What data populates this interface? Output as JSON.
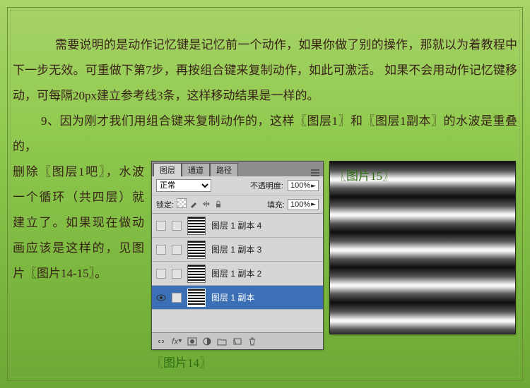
{
  "paragraphs": {
    "p1": "需要说明的是动作记忆键是记忆前一个动作，如果你做了别的操作，那就以为着教程中下一步无效。可重做下第7步，再按组合键来复制动作，如此可激活。 如果不会用动作记忆键移动，可每隔20px建立参考线3条，这样移动结果是一样的。",
    "p2": "9、因为刚才我们用组合键来复制动作的，这样〖图层1〗和〖图层1副本〗的水波是重叠的，",
    "p2b": "删除〖图层1吧〗，水波一个循环（共四层）就建立了。如果现在做动画应该是这样的，见图片〖图片14-15〗。",
    "caption14": "〖图片14〗",
    "caption15": "〖图片15〗"
  },
  "panel": {
    "tabs": {
      "layers": "图层",
      "channels": "通道",
      "paths": "路径"
    },
    "blend_mode": "正常",
    "labels": {
      "opacity": "不透明度:",
      "fill": "填充:",
      "lock": "锁定:"
    },
    "values": {
      "opacity": "100%",
      "fill": "100%"
    },
    "layers": [
      {
        "name": "图层 1 副本 4",
        "visible": false,
        "selected": false
      },
      {
        "name": "图层 1 副本 3",
        "visible": false,
        "selected": false
      },
      {
        "name": "图层 1 副本 2",
        "visible": false,
        "selected": false
      },
      {
        "name": "图层 1 副本",
        "visible": true,
        "selected": true
      }
    ]
  }
}
